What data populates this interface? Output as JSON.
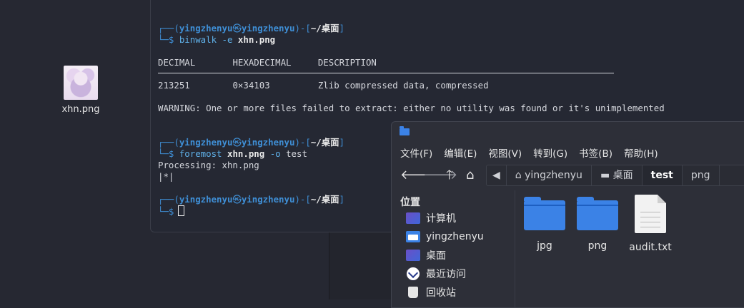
{
  "desktop": {
    "icon_label": "xhn.png"
  },
  "terminal": {
    "prompt1": {
      "user": "yingzhenyu",
      "host": "yingzhenyu",
      "path": "~/桌面"
    },
    "cmd1": {
      "name": "binwalk",
      "flag": "-e",
      "arg": "xhn.png"
    },
    "headers": [
      "DECIMAL",
      "HEXADECIMAL",
      "DESCRIPTION"
    ],
    "row": [
      "213251",
      "0×34103",
      "Zlib compressed data, compressed"
    ],
    "warning": "WARNING: One or more files failed to extract: either no utility was found or it's unimplemented",
    "prompt2": {
      "user": "yingzhenyu",
      "host": "yingzhenyu",
      "path": "~/桌面"
    },
    "cmd2": {
      "name": "foremost",
      "arg": "xhn.png",
      "flag": "-o",
      "target": "test"
    },
    "out1": "Processing: xhn.png",
    "out2": "|*|",
    "prompt3": {
      "user": "yingzhenyu",
      "host": "yingzhenyu",
      "path": "~/桌面"
    }
  },
  "file_manager": {
    "menu": [
      "文件(F)",
      "编辑(E)",
      "视图(V)",
      "转到(G)",
      "书签(B)",
      "帮助(H)"
    ],
    "path": [
      "yingzhenyu",
      "桌面",
      "test",
      "png"
    ],
    "sidebar_heading": "位置",
    "places": [
      "计算机",
      "yingzhenyu",
      "桌面",
      "最近访问",
      "回收站"
    ],
    "files": [
      "jpg",
      "png",
      "audit.txt"
    ]
  },
  "colors": {
    "accent": "#3b82e6",
    "prompt": "#3f8fd6",
    "command": "#5fb0e8"
  }
}
